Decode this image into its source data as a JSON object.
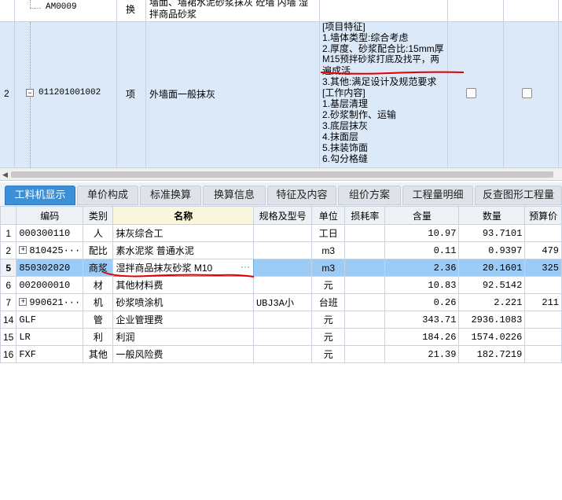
{
  "top_grid": {
    "row_prev": {
      "code": "AM0009",
      "type": "换",
      "name_line1": "墙面、墙裙水泥砂浆抹灰 砼墙 内墙 湿",
      "name_line2": "拌商品砂浆"
    },
    "row_selected": {
      "index": "2",
      "code": "011201001002",
      "type": "项",
      "name": "外墙面一般抹灰",
      "features": [
        "[项目特征]",
        "1.墙体类型:综合考虑",
        "2.厚度、砂浆配合比:15mm厚",
        "M15预拌砂浆打底及找平，两",
        "遍成活",
        "3.其他:满足设计及规范要求",
        "[工作内容]",
        "1.基层清理",
        "2.砂浆制作、运输",
        "3.底层抹灰",
        "4.抹面层",
        "5.抹装饰面",
        "6.勾分格缝"
      ]
    }
  },
  "tabs": [
    {
      "label": "工料机显示",
      "active": true
    },
    {
      "label": "单价构成",
      "active": false
    },
    {
      "label": "标准换算",
      "active": false
    },
    {
      "label": "换算信息",
      "active": false
    },
    {
      "label": "特征及内容",
      "active": false
    },
    {
      "label": "组价方案",
      "active": false
    },
    {
      "label": "工程量明细",
      "active": false
    },
    {
      "label": "反查图形工程量",
      "active": false
    }
  ],
  "table": {
    "headers": [
      "",
      "编码",
      "类别",
      "名称",
      "规格及型号",
      "单位",
      "损耗率",
      "含量",
      "数量",
      "预算价"
    ],
    "rows": [
      {
        "idx": "1",
        "code": "000300110",
        "expand": false,
        "cat": "人",
        "name": "抹灰综合工",
        "spec": "",
        "unit": "工日",
        "loss": "",
        "content": "10.97",
        "qty": "93.7101",
        "price": ""
      },
      {
        "idx": "2",
        "code": "810425···",
        "expand": true,
        "cat": "配比",
        "name": "素水泥浆 普通水泥",
        "spec": "",
        "unit": "m3",
        "loss": "",
        "content": "0.11",
        "qty": "0.9397",
        "price": "479"
      },
      {
        "idx": "5",
        "code": "850302020",
        "expand": false,
        "cat": "商浆",
        "name": "湿拌商品抹灰砂浆 M10",
        "spec": "",
        "unit": "m3",
        "loss": "",
        "content": "2.36",
        "qty": "20.1601",
        "price": "325",
        "selected": true
      },
      {
        "idx": "6",
        "code": "002000010",
        "expand": false,
        "cat": "材",
        "name": "其他材料费",
        "spec": "",
        "unit": "元",
        "loss": "",
        "content": "10.83",
        "qty": "92.5142",
        "price": ""
      },
      {
        "idx": "7",
        "code": "990621···",
        "expand": true,
        "cat": "机",
        "name": "砂浆喷涂机",
        "spec": "UBJ3A小",
        "unit": "台班",
        "loss": "",
        "content": "0.26",
        "qty": "2.221",
        "price": "211"
      },
      {
        "idx": "14",
        "code": "GLF",
        "expand": false,
        "cat": "管",
        "name": "企业管理费",
        "spec": "",
        "unit": "元",
        "loss": "",
        "content": "343.71",
        "qty": "2936.1083",
        "price": ""
      },
      {
        "idx": "15",
        "code": "LR",
        "expand": false,
        "cat": "利",
        "name": "利润",
        "spec": "",
        "unit": "元",
        "loss": "",
        "content": "184.26",
        "qty": "1574.0226",
        "price": ""
      },
      {
        "idx": "16",
        "code": "FXF",
        "expand": false,
        "cat": "其他",
        "name": "一般风险费",
        "spec": "",
        "unit": "元",
        "loss": "",
        "content": "21.39",
        "qty": "182.7219",
        "price": ""
      }
    ],
    "edit_button": "···"
  },
  "colors": {
    "accent": "#3d8fd8",
    "selected_row": "#9ccbf5",
    "annotation": "#e00000"
  }
}
